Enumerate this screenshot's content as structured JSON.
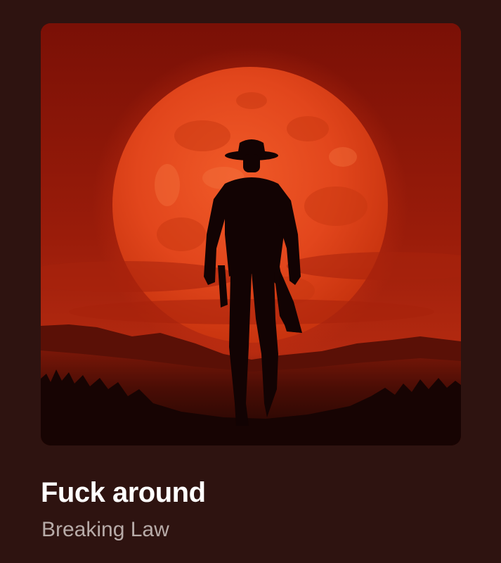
{
  "now_playing": {
    "artwork_icon": "cowboy-under-red-moon-artwork",
    "title": "Fuck around",
    "artist": "Breaking Law"
  },
  "colors": {
    "background": "#2e1310",
    "title": "#ffffff",
    "artist": "#b7aba8",
    "moon": "#e0431b",
    "sky": "#8a1608"
  }
}
